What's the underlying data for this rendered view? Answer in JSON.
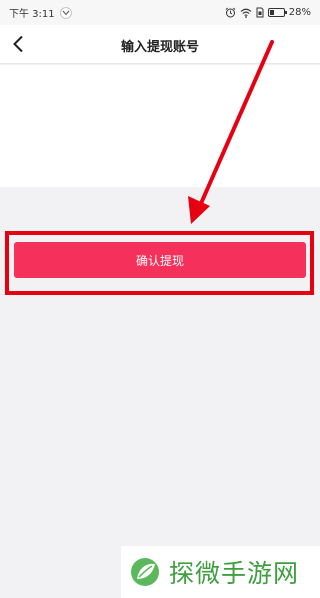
{
  "status_bar": {
    "time": "下午 3:11",
    "battery": "28%",
    "battery_level": 0.28
  },
  "nav": {
    "title": "输入提现账号"
  },
  "actions": {
    "confirm_label": "确认提现"
  },
  "annotation": {
    "color": "#e60012"
  },
  "watermark": {
    "text": "探微手游网",
    "logo": "leaf-logo"
  },
  "colors": {
    "accent": "#f5305a",
    "page_bg": "#f2f2f4",
    "watermark_green": "#3f9f3f"
  }
}
